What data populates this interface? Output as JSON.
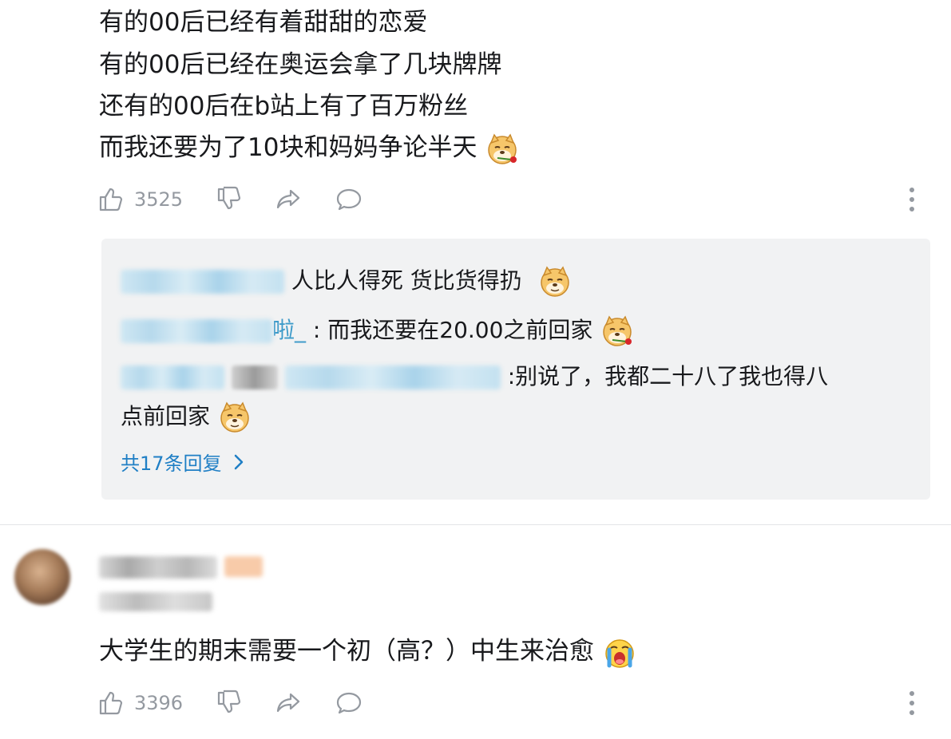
{
  "comment1": {
    "lines": [
      "有的00后已经有着甜甜的恋爱",
      "有的00后已经在奥运会拿了几块牌牌",
      "还有的00后在b站上有了百万粉丝",
      "而我还要为了10块和妈妈争论半天"
    ],
    "emoji": "doge-rose-emoji",
    "likes": "3525"
  },
  "replies": {
    "items": [
      {
        "text": "人比人得死 货比货得扔",
        "emoji": "doge-emoji"
      },
      {
        "name_suffix": "啦_",
        "text": ": 而我还要在20.00之前回家",
        "emoji": "doge-rose-emoji"
      },
      {
        "text": ":别说了，我都二十八了我也得八",
        "text2": "点前回家",
        "emoji": "doge-emoji"
      }
    ],
    "more_label": "共17条回复"
  },
  "comment2": {
    "text": "大学生的期末需要一个初（高？）中生来治愈",
    "emoji": "crying-emoji",
    "likes": "3396"
  },
  "colors": {
    "text": "#18191c",
    "muted": "#9499a0",
    "link": "#1f7fc5",
    "reply_bg": "#f1f2f3",
    "divider": "#e3e5e7"
  }
}
